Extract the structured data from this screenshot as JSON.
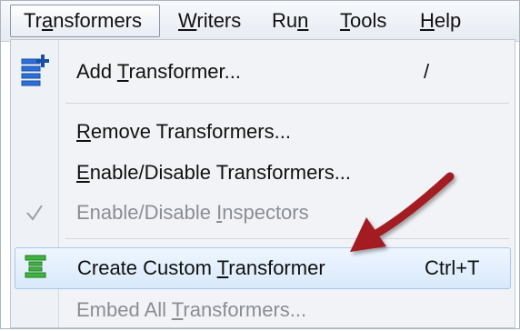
{
  "menubar": {
    "items": [
      {
        "pre": "Tr",
        "u": "a",
        "post": "nsformers"
      },
      {
        "pre": "",
        "u": "W",
        "post": "riters"
      },
      {
        "pre": "Ru",
        "u": "n",
        "post": ""
      },
      {
        "pre": "",
        "u": "T",
        "post": "ools"
      },
      {
        "pre": "",
        "u": "H",
        "post": "elp"
      }
    ]
  },
  "menu": {
    "add": {
      "pre": "Add ",
      "u": "T",
      "post": "ransformer...",
      "shortcut": "/"
    },
    "remove": {
      "pre": "",
      "u": "R",
      "post": "emove Transformers..."
    },
    "enable": {
      "pre": "",
      "u": "E",
      "post": "nable/Disable Transformers..."
    },
    "inspectors": {
      "pre": "Enable/Disable ",
      "u": "I",
      "post": "nspectors"
    },
    "create": {
      "pre": "Create Custom ",
      "u": "T",
      "post": "ransformer",
      "shortcut": "Ctrl+T"
    },
    "embed": {
      "pre": "Embed All ",
      "u": "T",
      "post": "ransformers..."
    }
  },
  "colors": {
    "accent_arrow": "#a31f24",
    "highlight_border": "#a9c6ea",
    "add_icon": "#2b6fd8",
    "custom_icon": "#3fb53f"
  },
  "icons": {
    "add": "add-transformer-icon",
    "check": "checkmark-icon",
    "custom": "custom-transformer-icon"
  }
}
